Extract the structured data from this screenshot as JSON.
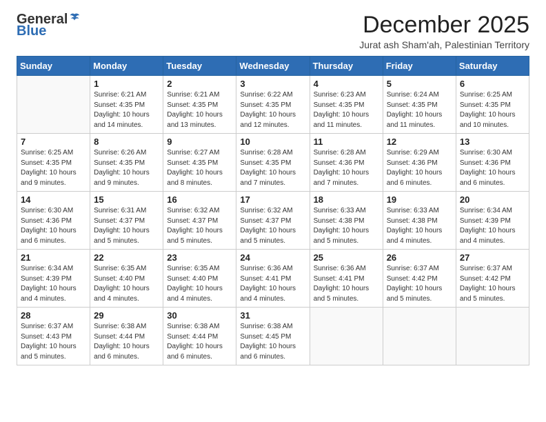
{
  "logo": {
    "general": "General",
    "blue": "Blue"
  },
  "title": "December 2025",
  "subtitle": "Jurat ash Sham'ah, Palestinian Territory",
  "days_of_week": [
    "Sunday",
    "Monday",
    "Tuesday",
    "Wednesday",
    "Thursday",
    "Friday",
    "Saturday"
  ],
  "weeks": [
    [
      {
        "day": "",
        "info": ""
      },
      {
        "day": "1",
        "info": "Sunrise: 6:21 AM\nSunset: 4:35 PM\nDaylight: 10 hours\nand 14 minutes."
      },
      {
        "day": "2",
        "info": "Sunrise: 6:21 AM\nSunset: 4:35 PM\nDaylight: 10 hours\nand 13 minutes."
      },
      {
        "day": "3",
        "info": "Sunrise: 6:22 AM\nSunset: 4:35 PM\nDaylight: 10 hours\nand 12 minutes."
      },
      {
        "day": "4",
        "info": "Sunrise: 6:23 AM\nSunset: 4:35 PM\nDaylight: 10 hours\nand 11 minutes."
      },
      {
        "day": "5",
        "info": "Sunrise: 6:24 AM\nSunset: 4:35 PM\nDaylight: 10 hours\nand 11 minutes."
      },
      {
        "day": "6",
        "info": "Sunrise: 6:25 AM\nSunset: 4:35 PM\nDaylight: 10 hours\nand 10 minutes."
      }
    ],
    [
      {
        "day": "7",
        "info": "Sunrise: 6:25 AM\nSunset: 4:35 PM\nDaylight: 10 hours\nand 9 minutes."
      },
      {
        "day": "8",
        "info": "Sunrise: 6:26 AM\nSunset: 4:35 PM\nDaylight: 10 hours\nand 9 minutes."
      },
      {
        "day": "9",
        "info": "Sunrise: 6:27 AM\nSunset: 4:35 PM\nDaylight: 10 hours\nand 8 minutes."
      },
      {
        "day": "10",
        "info": "Sunrise: 6:28 AM\nSunset: 4:35 PM\nDaylight: 10 hours\nand 7 minutes."
      },
      {
        "day": "11",
        "info": "Sunrise: 6:28 AM\nSunset: 4:36 PM\nDaylight: 10 hours\nand 7 minutes."
      },
      {
        "day": "12",
        "info": "Sunrise: 6:29 AM\nSunset: 4:36 PM\nDaylight: 10 hours\nand 6 minutes."
      },
      {
        "day": "13",
        "info": "Sunrise: 6:30 AM\nSunset: 4:36 PM\nDaylight: 10 hours\nand 6 minutes."
      }
    ],
    [
      {
        "day": "14",
        "info": "Sunrise: 6:30 AM\nSunset: 4:36 PM\nDaylight: 10 hours\nand 6 minutes."
      },
      {
        "day": "15",
        "info": "Sunrise: 6:31 AM\nSunset: 4:37 PM\nDaylight: 10 hours\nand 5 minutes."
      },
      {
        "day": "16",
        "info": "Sunrise: 6:32 AM\nSunset: 4:37 PM\nDaylight: 10 hours\nand 5 minutes."
      },
      {
        "day": "17",
        "info": "Sunrise: 6:32 AM\nSunset: 4:37 PM\nDaylight: 10 hours\nand 5 minutes."
      },
      {
        "day": "18",
        "info": "Sunrise: 6:33 AM\nSunset: 4:38 PM\nDaylight: 10 hours\nand 5 minutes."
      },
      {
        "day": "19",
        "info": "Sunrise: 6:33 AM\nSunset: 4:38 PM\nDaylight: 10 hours\nand 4 minutes."
      },
      {
        "day": "20",
        "info": "Sunrise: 6:34 AM\nSunset: 4:39 PM\nDaylight: 10 hours\nand 4 minutes."
      }
    ],
    [
      {
        "day": "21",
        "info": "Sunrise: 6:34 AM\nSunset: 4:39 PM\nDaylight: 10 hours\nand 4 minutes."
      },
      {
        "day": "22",
        "info": "Sunrise: 6:35 AM\nSunset: 4:40 PM\nDaylight: 10 hours\nand 4 minutes."
      },
      {
        "day": "23",
        "info": "Sunrise: 6:35 AM\nSunset: 4:40 PM\nDaylight: 10 hours\nand 4 minutes."
      },
      {
        "day": "24",
        "info": "Sunrise: 6:36 AM\nSunset: 4:41 PM\nDaylight: 10 hours\nand 4 minutes."
      },
      {
        "day": "25",
        "info": "Sunrise: 6:36 AM\nSunset: 4:41 PM\nDaylight: 10 hours\nand 5 minutes."
      },
      {
        "day": "26",
        "info": "Sunrise: 6:37 AM\nSunset: 4:42 PM\nDaylight: 10 hours\nand 5 minutes."
      },
      {
        "day": "27",
        "info": "Sunrise: 6:37 AM\nSunset: 4:42 PM\nDaylight: 10 hours\nand 5 minutes."
      }
    ],
    [
      {
        "day": "28",
        "info": "Sunrise: 6:37 AM\nSunset: 4:43 PM\nDaylight: 10 hours\nand 5 minutes."
      },
      {
        "day": "29",
        "info": "Sunrise: 6:38 AM\nSunset: 4:44 PM\nDaylight: 10 hours\nand 6 minutes."
      },
      {
        "day": "30",
        "info": "Sunrise: 6:38 AM\nSunset: 4:44 PM\nDaylight: 10 hours\nand 6 minutes."
      },
      {
        "day": "31",
        "info": "Sunrise: 6:38 AM\nSunset: 4:45 PM\nDaylight: 10 hours\nand 6 minutes."
      },
      {
        "day": "",
        "info": ""
      },
      {
        "day": "",
        "info": ""
      },
      {
        "day": "",
        "info": ""
      }
    ]
  ]
}
